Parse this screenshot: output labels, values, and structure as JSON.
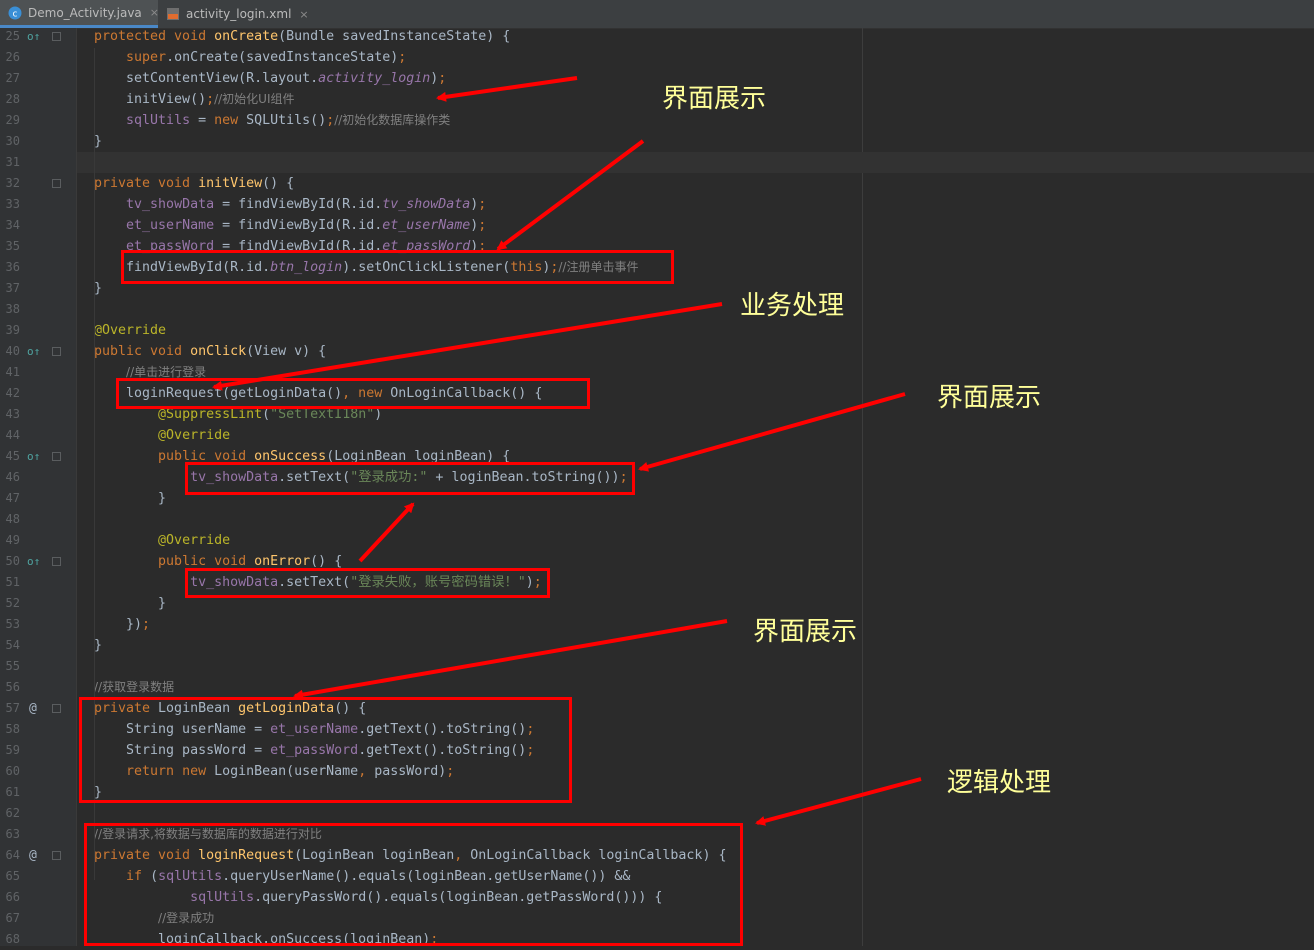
{
  "tabs": [
    {
      "label": "Demo_Activity.java",
      "icon": "java-class-icon",
      "active": true
    },
    {
      "label": "activity_login.xml",
      "icon": "xml-file-icon",
      "active": false
    }
  ],
  "close_glyph": "×",
  "lines": [
    {
      "n": "25",
      "marker": "o",
      "html": "<span class=\"kw\">protected void </span><span class=\"fn\">onCreate</span>(Bundle savedInstanceState) {"
    },
    {
      "n": "26",
      "html": "    <span class=\"kw\">super</span>.onCreate(savedInstanceState)<span class=\"kw\">;</span>"
    },
    {
      "n": "27",
      "html": "    setContentView(R.layout.<span class=\"fldi\">activity_login</span>)<span class=\"kw\">;</span>"
    },
    {
      "n": "28",
      "html": "    initView()<span class=\"kw\">;</span><span class=\"cm\">//初始化UI组件</span>"
    },
    {
      "n": "29",
      "html": "    <span class=\"fld\">sqlUtils</span> = <span class=\"kw\">new </span>SQLUtils()<span class=\"kw\">;</span><span class=\"cm\">//初始化数据库操作类</span>"
    },
    {
      "n": "30",
      "html": "}"
    },
    {
      "n": "31",
      "html": ""
    },
    {
      "n": "32",
      "html": "<span class=\"kw\">private void </span><span class=\"fn\">initView</span>() {"
    },
    {
      "n": "33",
      "html": "    <span class=\"fld\">tv_showData</span> = findViewById(R.id.<span class=\"fldi\">tv_showData</span>)<span class=\"kw\">;</span>"
    },
    {
      "n": "34",
      "html": "    <span class=\"fld\">et_userName</span> = findViewById(R.id.<span class=\"fldi\">et_userName</span>)<span class=\"kw\">;</span>"
    },
    {
      "n": "35",
      "html": "    <span class=\"fld\">et_passWord</span> = findViewById(R.id.<span class=\"fldi\">et_passWord</span>)<span class=\"kw\">;</span>"
    },
    {
      "n": "36",
      "html": "    findViewById(R.id.<span class=\"fldi\">btn_login</span>).setOnClickListener(<span class=\"kw\">this</span>)<span class=\"kw\">;</span><span class=\"cm\">//注册单击事件</span>"
    },
    {
      "n": "37",
      "html": "}"
    },
    {
      "n": "38",
      "html": ""
    },
    {
      "n": "39",
      "html": "<span class=\"ann\">@Override</span>"
    },
    {
      "n": "40",
      "marker": "o",
      "html": "<span class=\"kw\">public void </span><span class=\"fn\">onClick</span>(View v) {"
    },
    {
      "n": "41",
      "html": "    <span class=\"cm\">//单击进行登录</span>"
    },
    {
      "n": "42",
      "html": "    loginRequest(getLoginData()<span class=\"kw\">, new </span>OnLoginCallback() {"
    },
    {
      "n": "43",
      "html": "        <span class=\"ann\">@SuppressLint</span>(<span class=\"str\">\"SetTextI18n\"</span>)"
    },
    {
      "n": "44",
      "html": "        <span class=\"ann\">@Override</span>"
    },
    {
      "n": "45",
      "marker": "o",
      "html": "        <span class=\"kw\">public void </span><span class=\"fn\">onSuccess</span>(LoginBean loginBean) {"
    },
    {
      "n": "46",
      "html": "            <span class=\"fld\">tv_showData</span>.setText(<span class=\"str\">\"登录成功:\"</span> + loginBean.toString())<span class=\"kw\">;</span>"
    },
    {
      "n": "47",
      "html": "        }"
    },
    {
      "n": "48",
      "html": ""
    },
    {
      "n": "49",
      "html": "        <span class=\"ann\">@Override</span>"
    },
    {
      "n": "50",
      "marker": "o",
      "html": "        <span class=\"kw\">public void </span><span class=\"fn\">onError</span>() {"
    },
    {
      "n": "51",
      "html": "            <span class=\"fld\">tv_showData</span>.setText(<span class=\"str\">\"登录失败，账号密码错误！\"</span>)<span class=\"kw\">;</span>"
    },
    {
      "n": "52",
      "html": "        }"
    },
    {
      "n": "53",
      "html": "    })<span class=\"kw\">;</span>"
    },
    {
      "n": "54",
      "html": "}"
    },
    {
      "n": "55",
      "html": ""
    },
    {
      "n": "56",
      "html": "<span class=\"cm\">//获取登录数据</span>"
    },
    {
      "n": "57",
      "marker": "@",
      "html": "<span class=\"kw\">private </span>LoginBean <span class=\"fn\">getLoginData</span>() {"
    },
    {
      "n": "58",
      "html": "    String userName = <span class=\"fld\">et_userName</span>.getText().toString()<span class=\"kw\">;</span>"
    },
    {
      "n": "59",
      "html": "    String passWord = <span class=\"fld\">et_passWord</span>.getText().toString()<span class=\"kw\">;</span>"
    },
    {
      "n": "60",
      "html": "    <span class=\"kw\">return new </span>LoginBean(userName<span class=\"kw\">, </span>passWord)<span class=\"kw\">;</span>"
    },
    {
      "n": "61",
      "html": "}"
    },
    {
      "n": "62",
      "html": ""
    },
    {
      "n": "63",
      "html": "<span class=\"cm\">//登录请求,将数据与数据库的数据进行对比</span>"
    },
    {
      "n": "64",
      "marker": "@",
      "html": "<span class=\"kw\">private void </span><span class=\"fn\">loginRequest</span>(LoginBean loginBean<span class=\"kw\">, </span>OnLoginCallback loginCallback) {"
    },
    {
      "n": "65",
      "html": "    <span class=\"kw\">if </span>(<span class=\"fld\">sqlUtils</span>.queryUserName().equals(loginBean.getUserName()) &amp;&amp;"
    },
    {
      "n": "66",
      "html": "            <span class=\"fld\">sqlUtils</span>.queryPassWord().equals(loginBean.getPassWord())) {"
    },
    {
      "n": "67",
      "html": "        <span class=\"cm\">//登录成功</span>"
    },
    {
      "n": "68",
      "html": "        loginCallback.onSuccess(loginBean)<span class=\"kw\">;</span>"
    }
  ],
  "annotations": [
    {
      "id": "ui-1",
      "text": "界面展示"
    },
    {
      "id": "biz",
      "text": "业务处理"
    },
    {
      "id": "ui-2",
      "text": "界面展示"
    },
    {
      "id": "ui-3",
      "text": "界面展示"
    },
    {
      "id": "logic",
      "text": "逻辑处理"
    }
  ],
  "colors": {
    "annotation_text": "#ffff99",
    "arrow": "#ff0000",
    "box": "#ff0000"
  }
}
